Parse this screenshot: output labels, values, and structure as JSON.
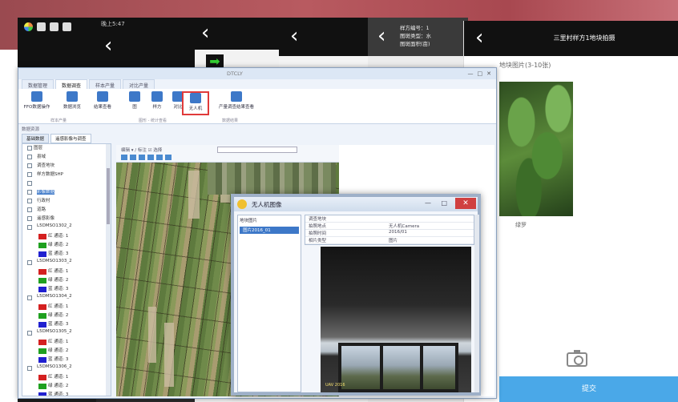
{
  "phones": {
    "p2_time": "晚上5:47",
    "p5_lines": [
      "样方编号：1",
      "图斑类型：水",
      "图斑面积(亩)"
    ]
  },
  "front_phone": {
    "title": "三里村样方1地块拍摄",
    "photo_label": "地块图片(3-10张)",
    "photo_caption": "绿罗",
    "button_label": "提交",
    "icons": [
      "back-chevron-icon",
      "camera-icon"
    ]
  },
  "main_window": {
    "title": "DTCLY",
    "ribbon_tabs": [
      "数据管理",
      "数据调查",
      "样本产量",
      "对比产量"
    ],
    "active_tab_index": 1,
    "ribbon_buttons": [
      {
        "label": "FFO数据操作",
        "name": "ffo-data-button"
      },
      {
        "label": "数据浏览",
        "name": "data-browse-button"
      },
      {
        "label": "结果查看",
        "name": "result-view-button"
      },
      {
        "label": "图",
        "name": "map-button"
      },
      {
        "label": "样方",
        "name": "sample-button"
      },
      {
        "label": "对比",
        "name": "compare-button"
      },
      {
        "label": "无人机",
        "name": "uav-button"
      },
      {
        "label": "产量调查结果查看",
        "name": "yield-result-button"
      }
    ],
    "group_labels": [
      "样本产量",
      "图形 - 统计查看",
      "数据结果"
    ],
    "panel_header": "数据资源",
    "panel_tabs": [
      "基础数据",
      "遥感影像与调查"
    ],
    "tree": {
      "nodes": [
        {
          "label": "图层",
          "level": 0
        },
        {
          "label": "县域",
          "level": 1
        },
        {
          "label": "调查地块",
          "level": 1
        },
        {
          "label": "样方数据SHP",
          "level": 1
        },
        {
          "label": "",
          "level": 1
        },
        {
          "label": "影像数据",
          "level": 1,
          "selected": true
        },
        {
          "label": "行政村",
          "level": 1
        },
        {
          "label": "道路",
          "level": 1
        },
        {
          "label": "遥感影像",
          "level": 1
        },
        {
          "label": "L5DMSO1302_2",
          "level": 1
        },
        {
          "label": "红 通道: 1",
          "level": 2,
          "color": "#d42020"
        },
        {
          "label": "绿 通道: 2",
          "level": 2,
          "color": "#20a020"
        },
        {
          "label": "蓝 通道: 3",
          "level": 2,
          "color": "#2020d0"
        },
        {
          "label": "L5DMSO1303_2",
          "level": 1
        },
        {
          "label": "红 通道: 1",
          "level": 2,
          "color": "#d42020"
        },
        {
          "label": "绿 通道: 2",
          "level": 2,
          "color": "#20a020"
        },
        {
          "label": "蓝 通道: 3",
          "level": 2,
          "color": "#2020d0"
        },
        {
          "label": "L5DMSO1304_2",
          "level": 1
        },
        {
          "label": "红 通道: 1",
          "level": 2,
          "color": "#d42020"
        },
        {
          "label": "绿 通道: 2",
          "level": 2,
          "color": "#20a020"
        },
        {
          "label": "蓝 通道: 3",
          "level": 2,
          "color": "#2020d0"
        },
        {
          "label": "L5DMSO1305_2",
          "level": 1
        },
        {
          "label": "红 通道: 1",
          "level": 2,
          "color": "#d42020"
        },
        {
          "label": "绿 通道: 2",
          "level": 2,
          "color": "#20a020"
        },
        {
          "label": "蓝 通道: 3",
          "level": 2,
          "color": "#2020d0"
        },
        {
          "label": "L5DMSO1306_2",
          "level": 1
        },
        {
          "label": "红 通道: 1",
          "level": 2,
          "color": "#d42020"
        },
        {
          "label": "绿 通道: 2",
          "level": 2,
          "color": "#20a020"
        },
        {
          "label": "蓝 通道: 3",
          "level": 2,
          "color": "#2020d0"
        }
      ]
    },
    "map_toolbar": {
      "label": "编辑 ▾ / 标注 ☑ 选择"
    }
  },
  "uav_dialog": {
    "title": "无人机图像",
    "left_items": [
      "地块图片",
      "图片2016_01"
    ],
    "props": [
      [
        "调查地块",
        ""
      ],
      [
        "拍照地点",
        "无人机Camera"
      ],
      [
        "拍照时间",
        "2016/01"
      ],
      [
        "相片类型",
        "图片"
      ]
    ],
    "photo_stamp": "UAV 2016"
  }
}
